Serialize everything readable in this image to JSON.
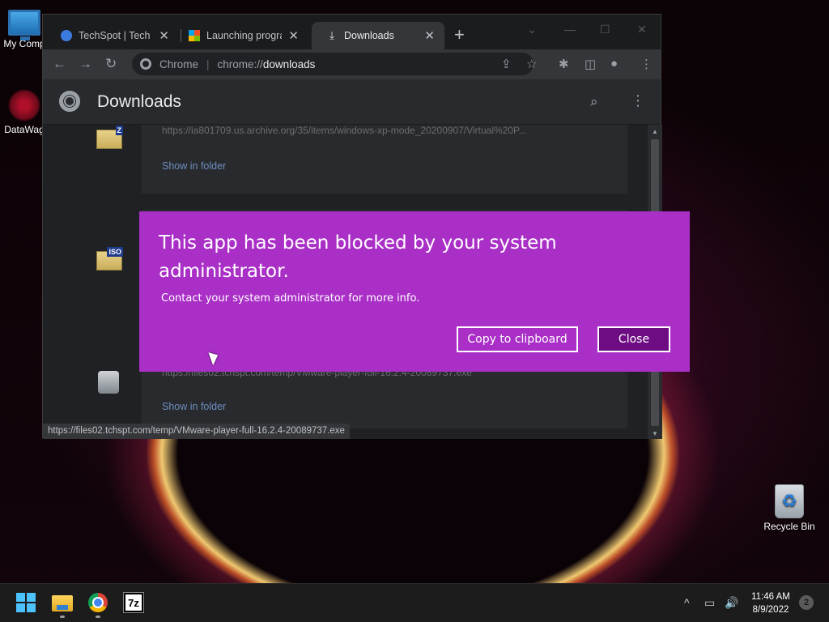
{
  "desktop": {
    "icons": [
      {
        "label": "My Comp"
      },
      {
        "label": "DataWag"
      },
      {
        "label": "Recycle Bin"
      }
    ]
  },
  "browser": {
    "tabs": [
      {
        "title": "TechSpot | Tech E",
        "icon": "techspot-icon"
      },
      {
        "title": "Launching progra",
        "icon": "microsoft-icon"
      },
      {
        "title": "Downloads",
        "icon": "download-icon"
      }
    ],
    "active_tab": 2,
    "omnibox": {
      "site": "Chrome",
      "scheme": "chrome://",
      "path": "downloads"
    },
    "page": {
      "title": "Downloads",
      "items": [
        {
          "url": "https://ia801709.us.archive.org/35/items/windows-xp-mode_20200907/Virtual%20P...",
          "action": "Show in folder",
          "file_tag": "Z"
        },
        {
          "url": "",
          "action": "",
          "file_tag": "ISO"
        },
        {
          "url": "https://files02.tchspt.com/temp/VMware-player-full-16.2.4-20089737.exe",
          "action": "Show in folder",
          "file_tag": ""
        }
      ]
    },
    "status_bar_url": "https://files02.tchspt.com/temp/VMware-player-full-16.2.4-20089737.exe"
  },
  "dialog": {
    "title": "This app has been blocked by your system administrator.",
    "message": "Contact your system administrator for more info.",
    "copy_label": "Copy to clipboard",
    "close_label": "Close",
    "accent": "#aa2fc7"
  },
  "taskbar": {
    "time": "11:46 AM",
    "date": "8/9/2022",
    "notifications": "2",
    "sevenzip_label": "7z"
  }
}
